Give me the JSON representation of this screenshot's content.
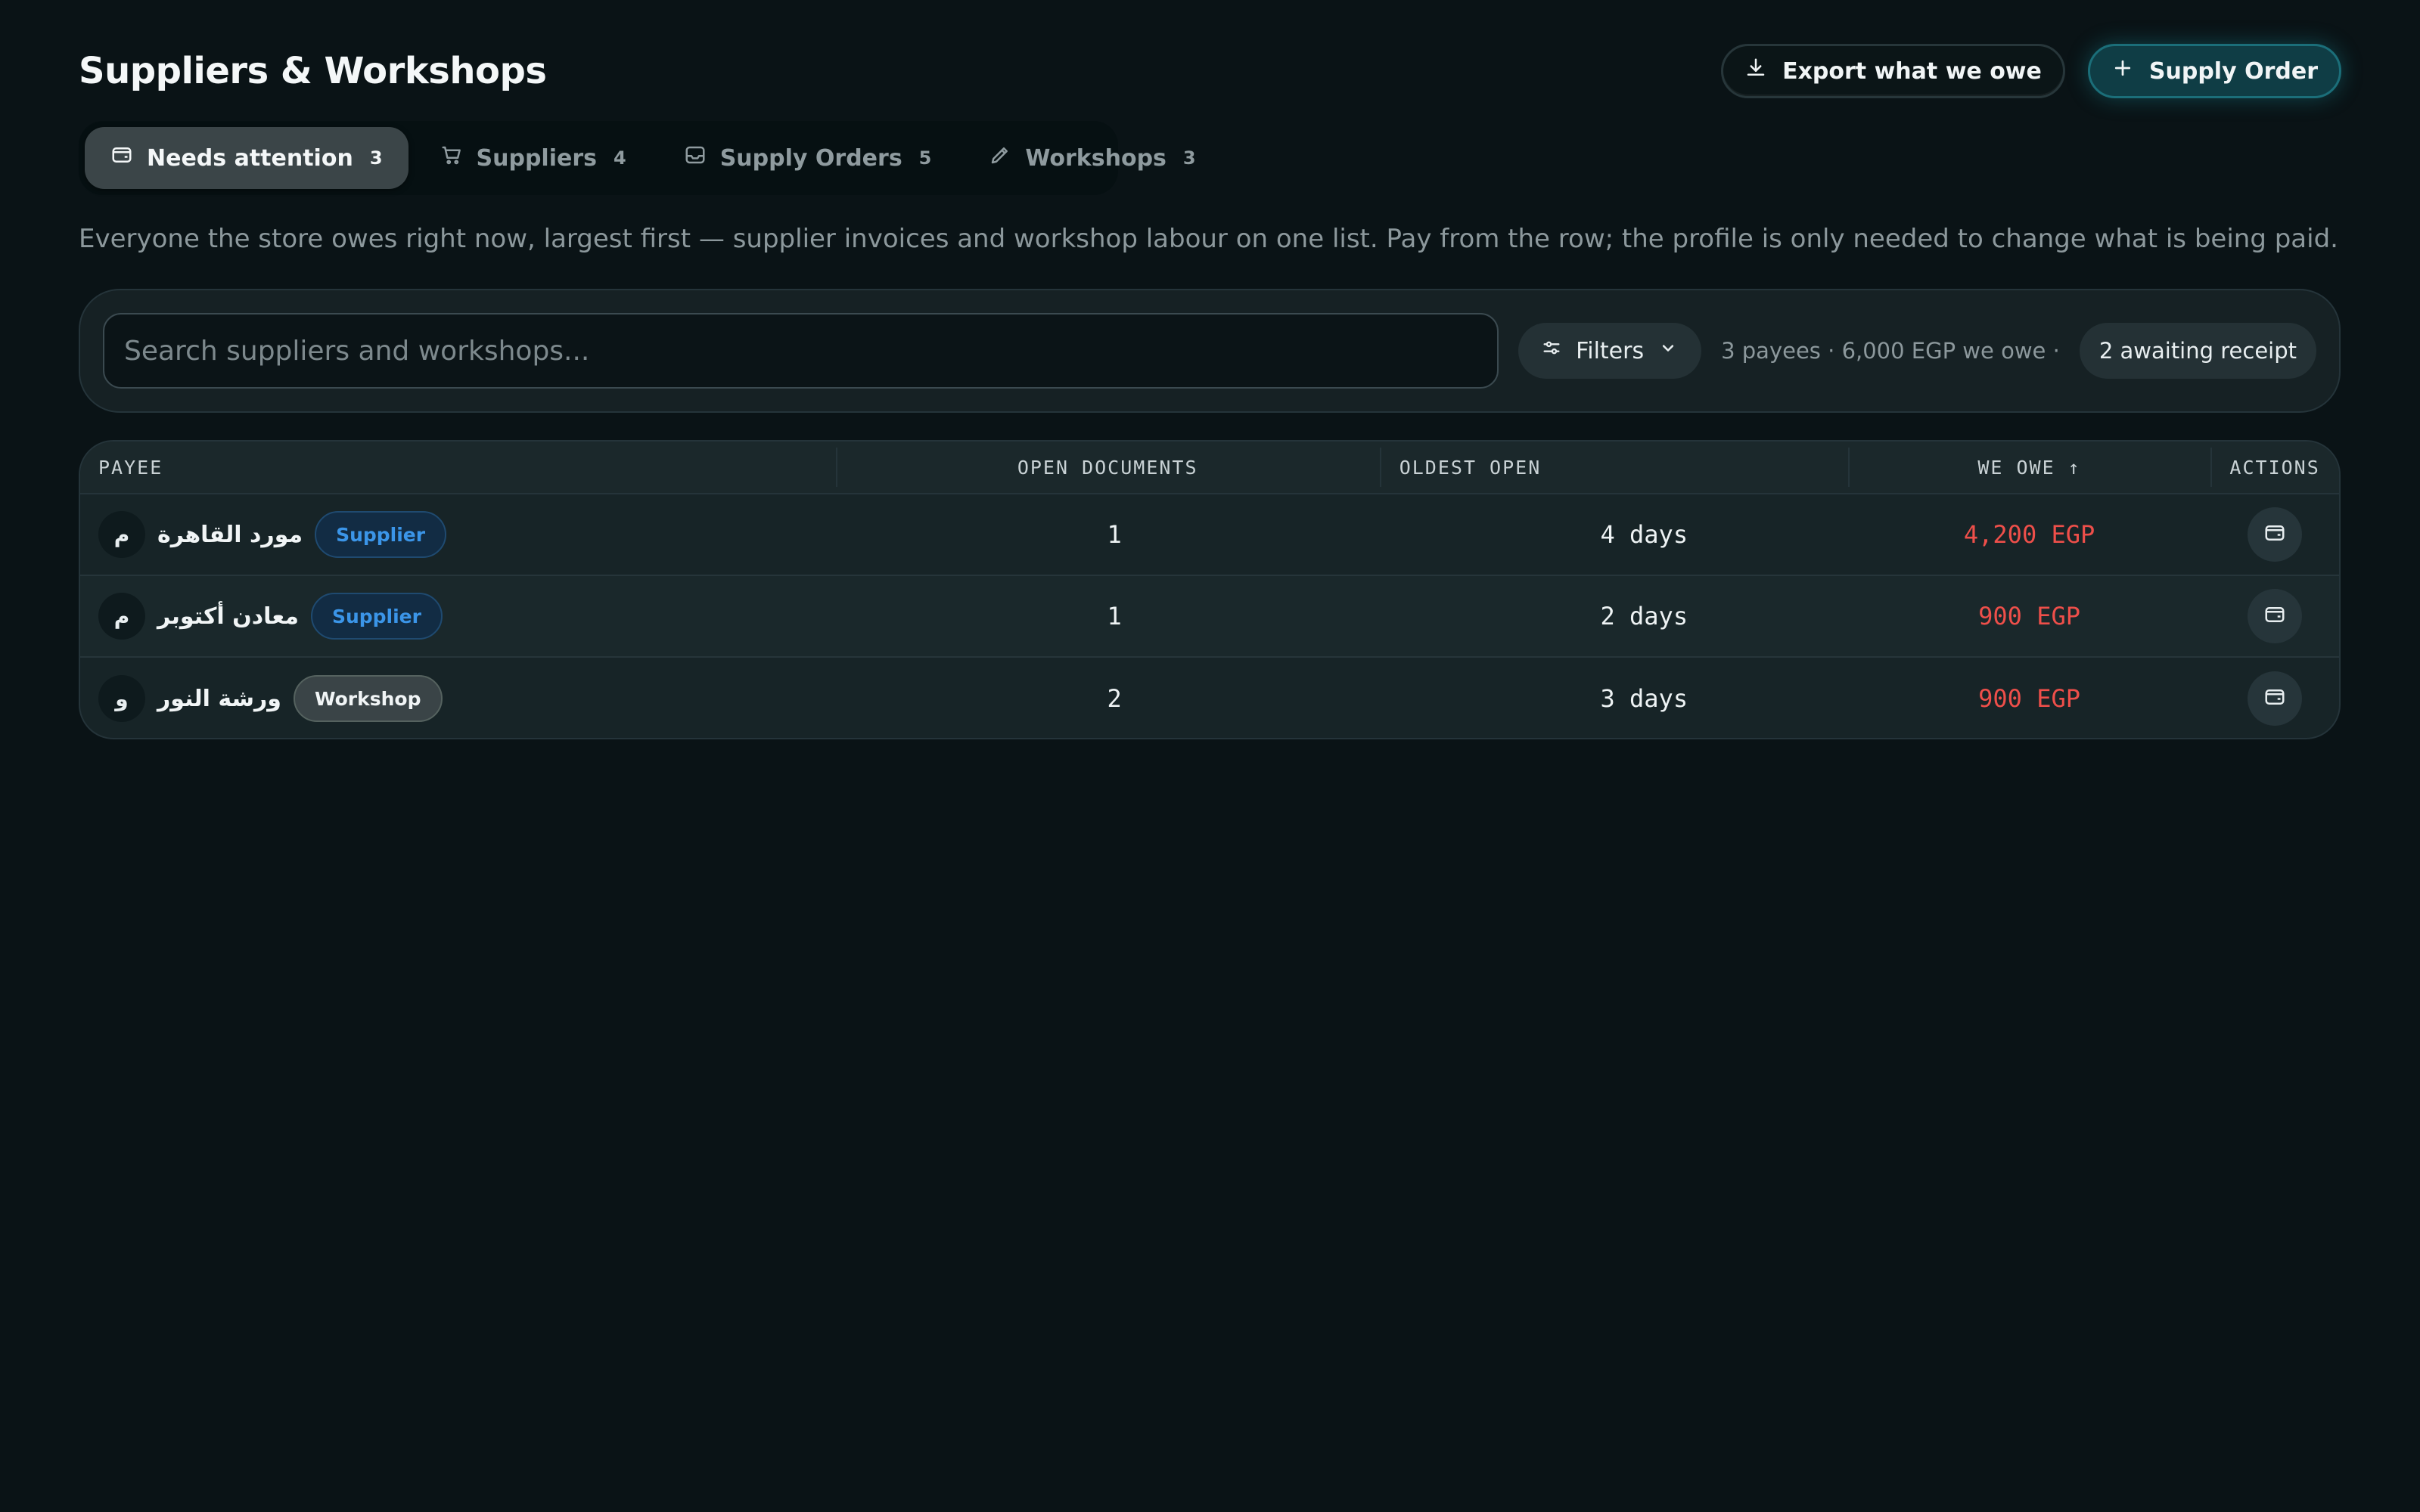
{
  "header": {
    "title": "Suppliers & Workshops",
    "export_label": "Export what we owe",
    "export_icon": "download-icon",
    "primary_label": "Supply Order",
    "primary_icon": "plus-icon"
  },
  "tabs": [
    {
      "label": "Needs attention",
      "count": "3",
      "icon": "wallet-icon",
      "active": true
    },
    {
      "label": "Suppliers",
      "count": "4",
      "icon": "cart-icon",
      "active": false
    },
    {
      "label": "Supply Orders",
      "count": "5",
      "icon": "inbox-icon",
      "active": false
    },
    {
      "label": "Workshops",
      "count": "3",
      "icon": "pencil-icon",
      "active": false
    }
  ],
  "description": "Everyone the store owes right now, largest first — supplier invoices and workshop labour on one list. Pay from the row; the profile is only needed to change what is being paid.",
  "search": {
    "placeholder": "Search suppliers and workshops...",
    "value": ""
  },
  "filters_label": "Filters",
  "summary": "3 payees · 6,000 EGP we owe ·",
  "awaiting_label": "2 awaiting receipt",
  "table": {
    "headers": {
      "payee": "PAYEE",
      "documents": "OPEN DOCUMENTS",
      "oldest": "OLDEST OPEN",
      "owe": "WE OWE ↑",
      "actions": "ACTIONS"
    },
    "rows": [
      {
        "initial": "م",
        "name": "مورد القاهرة",
        "type": "Supplier",
        "documents": "1",
        "oldest": "4 days",
        "owe": "4,200 EGP"
      },
      {
        "initial": "م",
        "name": "معادن أكتوبر",
        "type": "Supplier",
        "documents": "1",
        "oldest": "2 days",
        "owe": "900 EGP"
      },
      {
        "initial": "و",
        "name": "ورشة النور",
        "type": "Workshop",
        "documents": "2",
        "oldest": "3 days",
        "owe": "900 EGP"
      }
    ]
  },
  "colors": {
    "background": "#0a1316",
    "accent": "#1b6e79",
    "owe": "#ee4f4a",
    "supplier_badge": "#3b95e8"
  }
}
